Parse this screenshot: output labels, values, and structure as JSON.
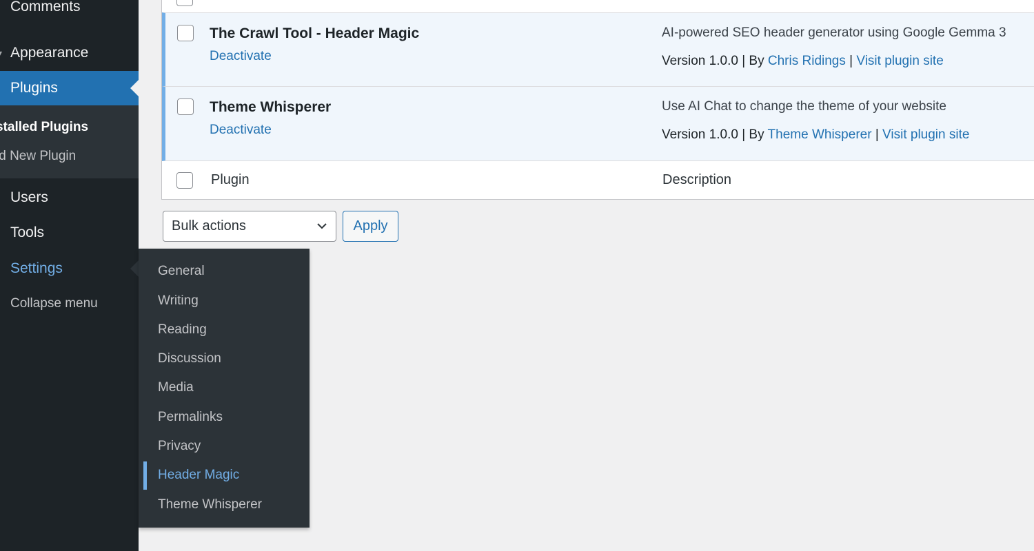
{
  "sidebar": {
    "comments": "Comments",
    "appearance": "Appearance",
    "plugins": "Plugins",
    "installed_plugins": "stalled Plugins",
    "add_new_plugin": "ld New Plugin",
    "users": "Users",
    "tools": "Tools",
    "settings": "Settings",
    "collapse": "Collapse menu"
  },
  "settings_flyout": {
    "items": [
      "General",
      "Writing",
      "Reading",
      "Discussion",
      "Media",
      "Permalinks",
      "Privacy",
      "Header Magic",
      "Theme Whisperer"
    ],
    "current": "Header Magic"
  },
  "plugins": [
    {
      "name": "The Crawl Tool - Header Magic",
      "action": "Deactivate",
      "description": "AI-powered SEO header generator using Google Gemma 3",
      "version": "Version 1.0.0",
      "by": "By",
      "author": "Chris Ridings",
      "site_link": "Visit plugin site"
    },
    {
      "name": "Theme Whisperer",
      "action": "Deactivate",
      "description": "Use AI Chat to change the theme of your website",
      "version": "Version 1.0.0",
      "by": "By",
      "author": "Theme Whisperer",
      "site_link": "Visit plugin site"
    }
  ],
  "table_footer": {
    "plugin_col": "Plugin",
    "description_col": "Description"
  },
  "bulk_actions": {
    "selected": "Bulk actions",
    "apply": "Apply"
  },
  "colors": {
    "sidebar_bg": "#1d2327",
    "submenu_bg": "#2c3338",
    "accent": "#2271b1",
    "accent_light": "#72aee6"
  }
}
